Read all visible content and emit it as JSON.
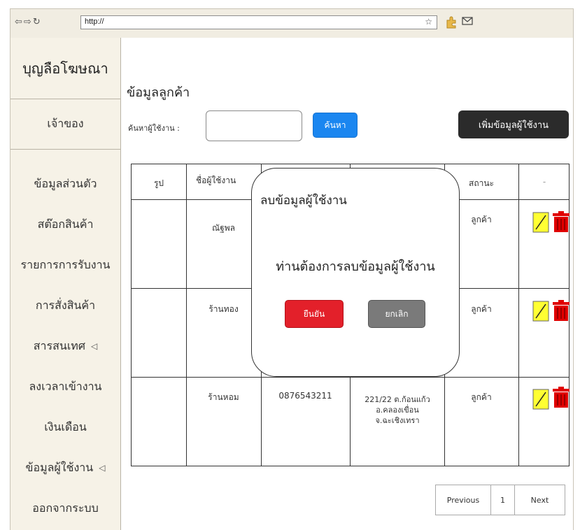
{
  "browser": {
    "url": "http://"
  },
  "sidebar": {
    "brand": "บุญลือโฆษณา",
    "owner": "เจ้าของ",
    "items": [
      {
        "label": "ข้อมูลส่วนตัว",
        "arrow": ""
      },
      {
        "label": "สต๊อกสินค้า",
        "arrow": ""
      },
      {
        "label": "รายการการรับงาน",
        "arrow": ""
      },
      {
        "label": "การสั่งสินค้า",
        "arrow": ""
      },
      {
        "label": "สารสนเทศ",
        "arrow": "◁"
      },
      {
        "label": "ลงเวลาเข้างาน",
        "arrow": ""
      },
      {
        "label": "เงินเดือน",
        "arrow": ""
      },
      {
        "label": "ข้อมูลผู้ใช้งาน",
        "arrow": "◁"
      },
      {
        "label": "ออกจากระบบ",
        "arrow": ""
      }
    ]
  },
  "main": {
    "title": "ข้อมูลลูกค้า",
    "search_label": "ค้นหาผู้ใช้งาน :",
    "search_value": "",
    "search_button": "ค้นหา",
    "add_button": "เพิ่มข้อมูลผู้ใช้งาน"
  },
  "table": {
    "headers": {
      "photo": "รูป",
      "username": "ชื่อผู้ใช้งาน",
      "status": "สถานะ",
      "actions": "-"
    },
    "rows": [
      {
        "username": "ณัฐพล",
        "phone": "",
        "address": "",
        "status": "ลูกค้า"
      },
      {
        "username": "ร้านทอง",
        "phone": "",
        "address": "",
        "status": "ลูกค้า"
      },
      {
        "username": "ร้านหอม",
        "phone": "0876543211",
        "address": "221/22 ต.ก้อนแก้ว อ.คลองเขื่อน จ.ฉะเชิงเทรา",
        "status": "ลูกค้า"
      }
    ]
  },
  "pagination": {
    "previous": "Previous",
    "page": "1",
    "next": "Next"
  },
  "modal": {
    "title": "ลบข้อมูลผู้ใช้งาน",
    "message": "ท่านต้องการลบข้อมูลผู้ใช้งาน",
    "confirm": "ยืนยัน",
    "cancel": "ยกเลิก"
  },
  "colors": {
    "search_button": "#1a86f0",
    "add_button": "#2b2b2b",
    "confirm_button": "#e3202a",
    "cancel_button": "#7a7a7a",
    "edit_icon": "#ffff33",
    "trash_icon": "#e00000"
  },
  "icons": [
    "back-arrow-icon",
    "forward-arrow-icon",
    "refresh-icon",
    "star-icon",
    "extension-icon",
    "mail-icon",
    "edit-icon",
    "trash-icon"
  ]
}
